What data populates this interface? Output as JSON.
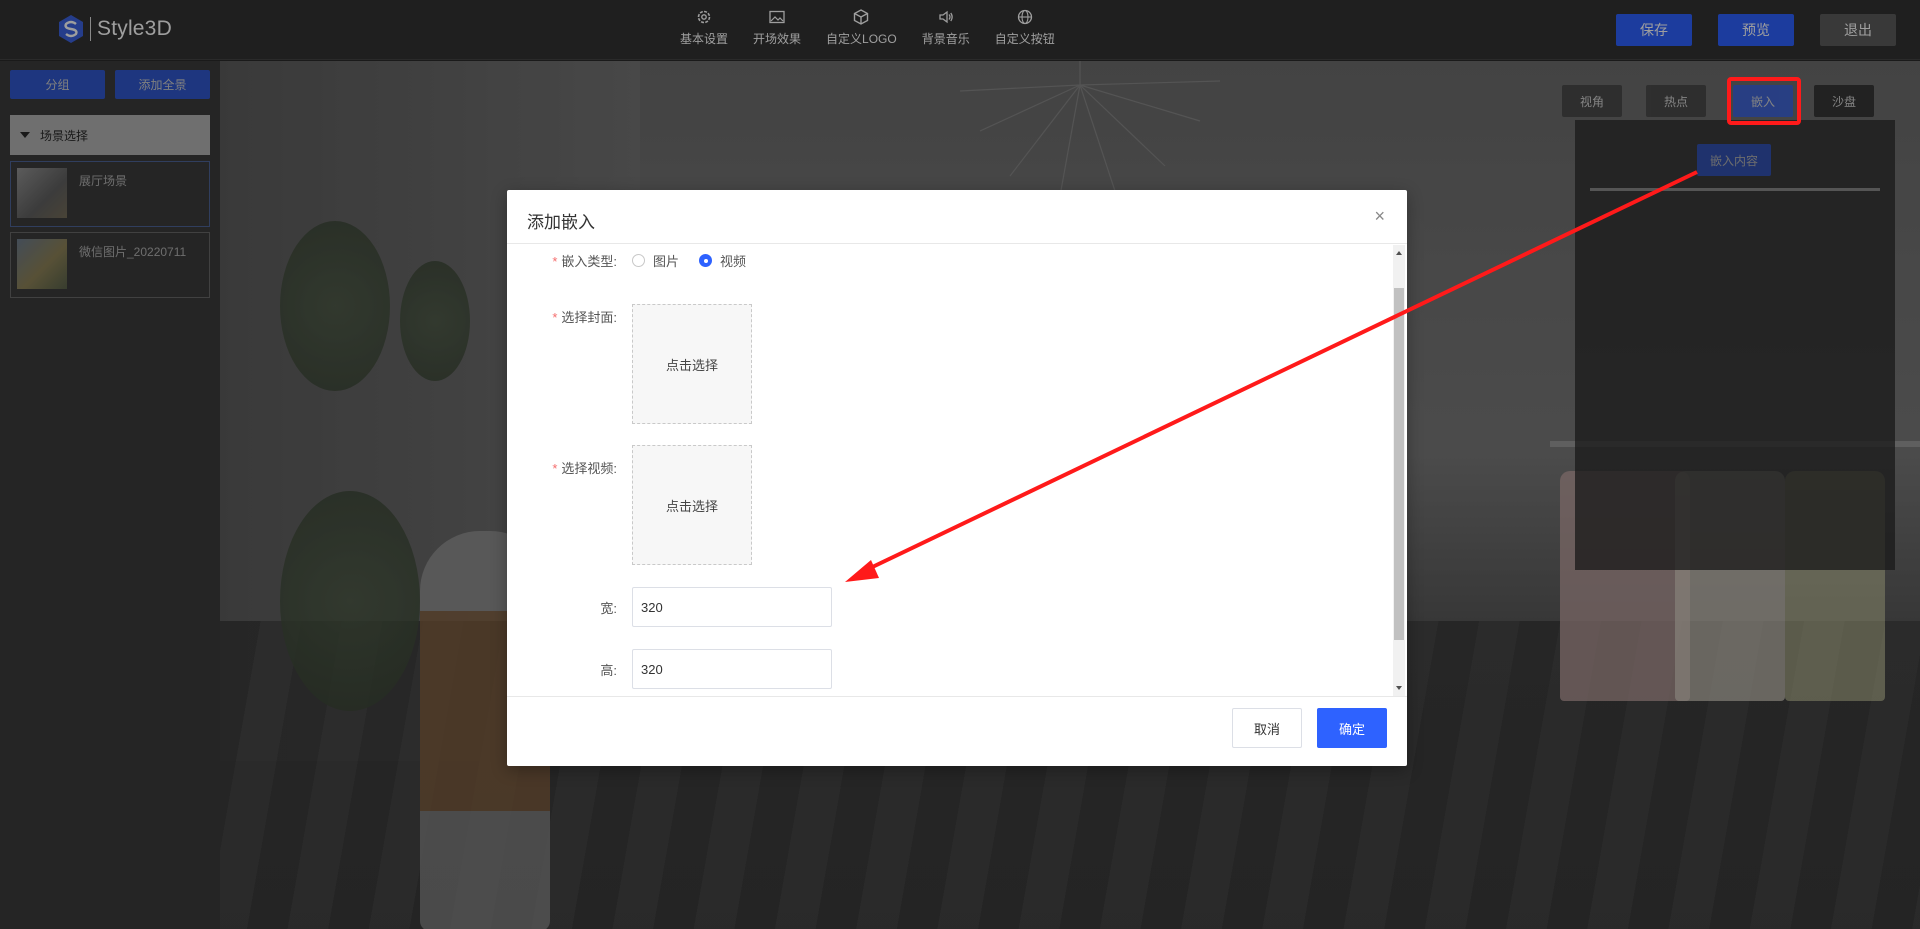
{
  "app": {
    "logo_text": "Style3D"
  },
  "topnav": [
    {
      "label": "基本设置",
      "icon": "gear-icon"
    },
    {
      "label": "开场效果",
      "icon": "image-icon"
    },
    {
      "label": "自定义LOGO",
      "icon": "cube-icon"
    },
    {
      "label": "背景音乐",
      "icon": "speaker-icon"
    },
    {
      "label": "自定义按钮",
      "icon": "globe-icon"
    }
  ],
  "top_actions": {
    "save": "保存",
    "preview": "预览",
    "exit": "退出"
  },
  "sidebar": {
    "group_btn": "分组",
    "add_all_btn": "添加全景",
    "scene_header": "场景选择",
    "scenes": [
      {
        "label": "展厅场景"
      },
      {
        "label": "微信图片_20220711"
      }
    ]
  },
  "viewport_tabs": {
    "view": "视角",
    "hotspot": "热点",
    "embed": "嵌入",
    "sandtable": "沙盘"
  },
  "right_panel": {
    "embed_content_btn": "嵌入内容"
  },
  "modal": {
    "title": "添加嵌入",
    "close": "×",
    "embed_type_label": "嵌入类型:",
    "type_options": [
      {
        "label": "图片",
        "checked": false
      },
      {
        "label": "视频",
        "checked": true
      }
    ],
    "cover_label": "选择封面:",
    "cover_uploader": "点击选择",
    "video_label": "选择视频:",
    "video_uploader": "点击选择",
    "width_label": "宽:",
    "width_value": "320",
    "height_label": "高:",
    "height_value": "320",
    "cancel": "取消",
    "confirm": "确定"
  },
  "colors": {
    "accent": "#2e62ff",
    "annotation_red": "#ff1a1a"
  }
}
